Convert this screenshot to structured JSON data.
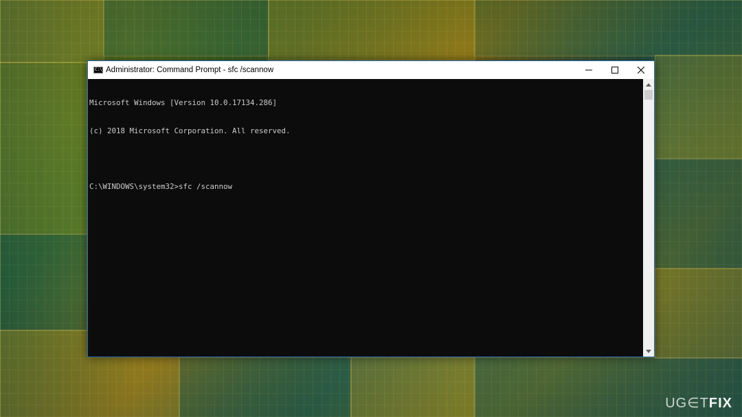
{
  "window": {
    "title": "Administrator: Command Prompt - sfc  /scannow",
    "icon": "command-prompt-icon",
    "app_icon_glyph": "C:\\",
    "controls": {
      "minimize_icon": "minimize-icon",
      "maximize_icon": "maximize-icon",
      "close_icon": "close-icon"
    },
    "accent_color": "#2b6cb0"
  },
  "console": {
    "background_color": "#0c0c0c",
    "text_color": "#cccccc",
    "lines": [
      "Microsoft Windows [Version 10.0.17134.286]",
      "(c) 2018 Microsoft Corporation. All reserved.",
      "",
      "C:\\WINDOWS\\system32>sfc /scannow"
    ]
  },
  "scrollbar": {
    "up_icon": "scroll-up-arrow-icon",
    "down_icon": "scroll-down-arrow-icon"
  },
  "watermark": {
    "left": "UG",
    "middle": "∈T",
    "right": "FIX"
  }
}
